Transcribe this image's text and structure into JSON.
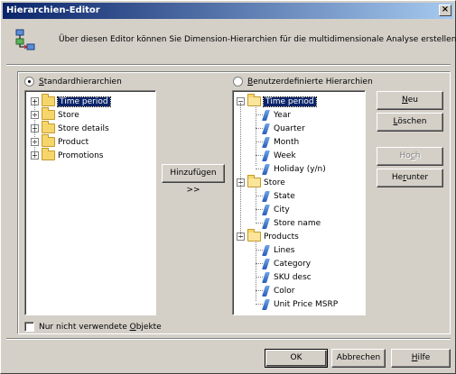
{
  "window": {
    "title": "Hierarchien-Editor",
    "close_glyph": "×"
  },
  "header": {
    "text": "Über diesen Editor können Sie Dimension-Hierarchien für die multidimensionale Analyse erstellen."
  },
  "left": {
    "radio_label": "Standardhierarchien",
    "radio_checked": true,
    "items": [
      {
        "label": "Time period",
        "selected": true
      },
      {
        "label": "Store"
      },
      {
        "label": "Store details"
      },
      {
        "label": "Product"
      },
      {
        "label": "Promotions"
      }
    ]
  },
  "add_button": "Hinzufügen >>",
  "right": {
    "radio_label": "Benutzerdefinierte Hierarchien",
    "radio_checked": false,
    "groups": [
      {
        "label": "Time period",
        "selected": true,
        "children": [
          "Year",
          "Quarter",
          "Month",
          "Week",
          "Holiday (y/n)"
        ]
      },
      {
        "label": "Store",
        "children": [
          "State",
          "City",
          "Store name"
        ]
      },
      {
        "label": "Products",
        "children": [
          "Lines",
          "Category",
          "SKU desc",
          "Color",
          "Unit Price MSRP"
        ]
      }
    ]
  },
  "side_buttons": {
    "new": "Neu",
    "delete": "Löschen",
    "up": "Hoch",
    "down": "Herunter"
  },
  "checkbox": {
    "label": "Nur nicht verwendete Objekte",
    "checked": false
  },
  "footer": {
    "ok": "OK",
    "cancel": "Abbrechen",
    "help": "Hilfe"
  },
  "colors": {
    "title_bar": "#0a246a",
    "selection": "#0a246a",
    "face": "#d4d0c8",
    "folder": "#f6d66b",
    "dimension_icon": "#2a5bb8"
  },
  "icons": {
    "header": "hierarchy-editor-icon",
    "expander": "plus-minus-box",
    "folder": "folder-icon",
    "dimension": "dimension-icon"
  }
}
